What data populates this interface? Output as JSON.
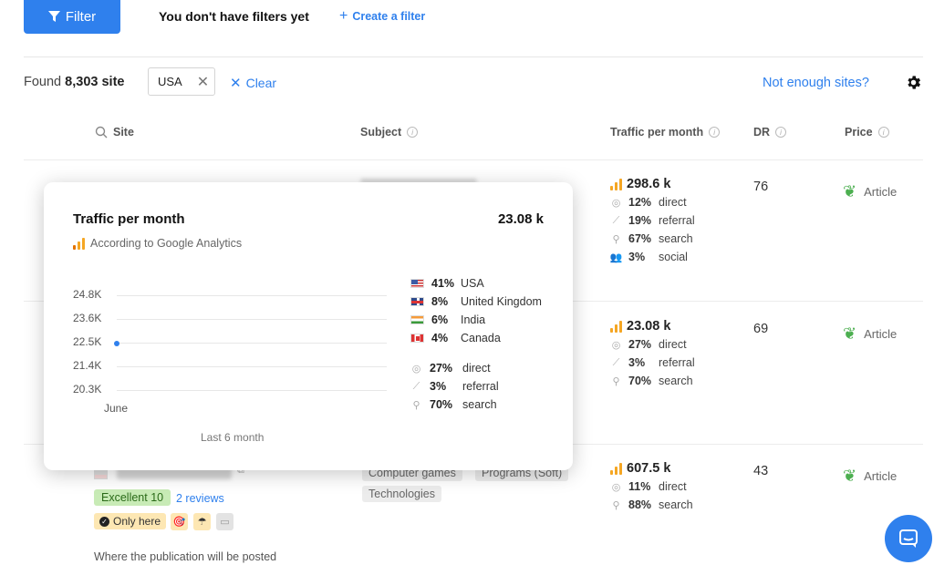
{
  "topbar": {
    "filter_label": "Filter",
    "no_filters": "You don't have filters yet",
    "create_filter": "Create a filter"
  },
  "results": {
    "found_prefix": "Found",
    "found_count": "8,303 site",
    "chip_label": "USA",
    "clear_label": "Clear",
    "not_enough": "Not enough sites?"
  },
  "table": {
    "headers": {
      "site": "Site",
      "subject": "Subject",
      "traffic": "Traffic per month",
      "dr": "DR",
      "price": "Price"
    },
    "rows": [
      {
        "traffic_total": "298.6 k",
        "lines": [
          {
            "pct": "12%",
            "label": "direct",
            "icon": "direct-icon"
          },
          {
            "pct": "19%",
            "label": "referral",
            "icon": "referral-icon"
          },
          {
            "pct": "67%",
            "label": "search",
            "icon": "search-icon"
          },
          {
            "pct": "3%",
            "label": "social",
            "icon": "social-icon"
          }
        ],
        "dr": "76",
        "price": "Article"
      },
      {
        "traffic_total": "23.08 k",
        "lines": [
          {
            "pct": "27%",
            "label": "direct",
            "icon": "direct-icon"
          },
          {
            "pct": "3%",
            "label": "referral",
            "icon": "referral-icon"
          },
          {
            "pct": "70%",
            "label": "search",
            "icon": "search-icon"
          }
        ],
        "dr": "69",
        "price": "Article"
      },
      {
        "traffic_total": "607.5 k",
        "lines": [
          {
            "pct": "11%",
            "label": "direct",
            "icon": "direct-icon"
          },
          {
            "pct": "88%",
            "label": "search",
            "icon": "search-icon"
          }
        ],
        "dr": "43",
        "price": "Article",
        "tags": [
          "Computer games",
          "Programs (Soft)",
          "Technologies"
        ],
        "rating": "Excellent 10",
        "reviews": "2 reviews",
        "only_here": "Only here",
        "where": "Where the publication will be posted"
      }
    ]
  },
  "popup": {
    "title": "Traffic per month",
    "total": "23.08 k",
    "source": "According to Google Analytics",
    "y_ticks": [
      "24.8K",
      "23.6K",
      "22.5K",
      "21.4K",
      "20.3K"
    ],
    "x_label": "June",
    "footer": "Last 6 month",
    "countries": [
      {
        "pct": "41%",
        "name": "USA",
        "flag": "us"
      },
      {
        "pct": "8%",
        "name": "United Kingdom",
        "flag": "uk"
      },
      {
        "pct": "6%",
        "name": "India",
        "flag": "in"
      },
      {
        "pct": "4%",
        "name": "Canada",
        "flag": "ca"
      }
    ],
    "sources": [
      {
        "pct": "27%",
        "label": "direct",
        "icon": "direct-icon"
      },
      {
        "pct": "3%",
        "label": "referral",
        "icon": "referral-icon"
      },
      {
        "pct": "70%",
        "label": "search",
        "icon": "search-icon"
      }
    ]
  },
  "chart_data": {
    "type": "line",
    "title": "Traffic per month",
    "x": [
      "June"
    ],
    "series": [
      {
        "values": [
          22.5
        ]
      }
    ],
    "ylabel": "",
    "xlabel": "",
    "y_ticks": [
      24.8,
      23.6,
      22.5,
      21.4,
      20.3
    ],
    "ylim": [
      20.3,
      24.8
    ],
    "y_unit": "K",
    "grid": true
  },
  "colors": {
    "accent": "#2f80ed",
    "traffic_bars": "#f5a623",
    "excellent_badge": "#c8ebb6",
    "leaf": "#4caf50"
  }
}
